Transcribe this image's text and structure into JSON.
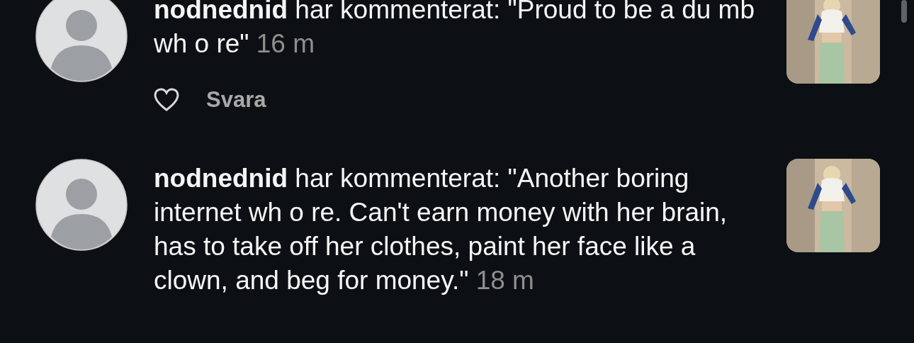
{
  "notifications": [
    {
      "username": "nodnednid",
      "action": "har kommenterat:",
      "comment": "\"Proud to be a du mb wh o re\"",
      "time": "16 m",
      "liked": false,
      "reply_label": "Svara"
    },
    {
      "username": "nodnednid",
      "action": "har kommenterat:",
      "comment": "\"Another boring internet wh o re. Can't earn money with her brain, has to take off her clothes, paint her face like a clown, and beg for money.\"",
      "time": "18 m"
    }
  ]
}
